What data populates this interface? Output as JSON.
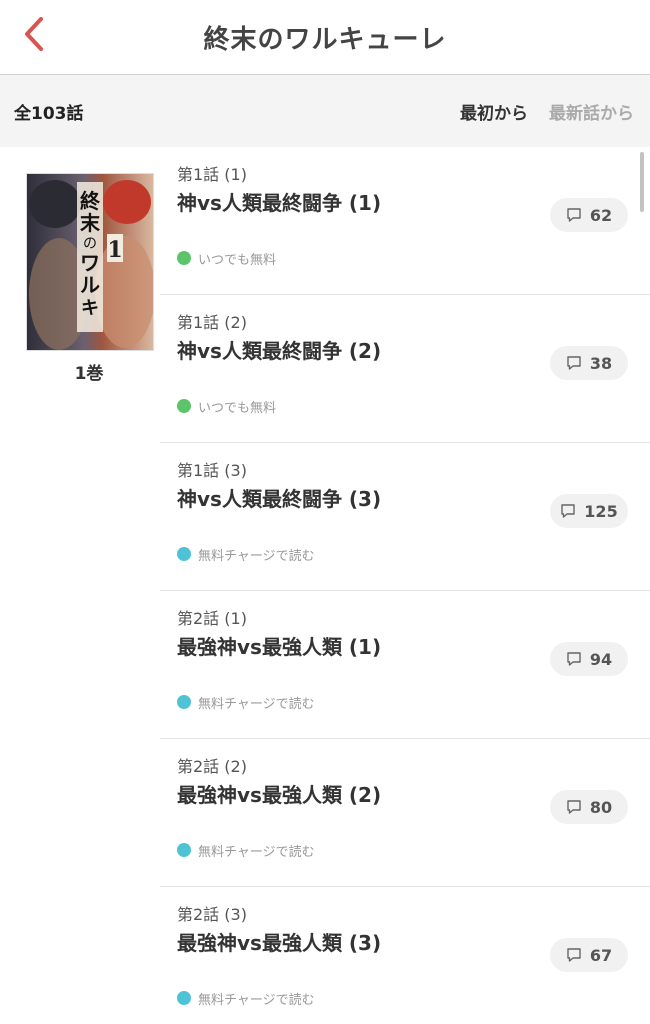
{
  "header": {
    "title": "終末のワルキューレ",
    "back_icon": "chevron-left-icon",
    "accent_color": "#d9534f"
  },
  "subbar": {
    "total": "全103話",
    "sort_first": "最初から",
    "sort_latest": "最新話から"
  },
  "volume": {
    "label": "1巻",
    "cover_title": "終末のワルキューレ",
    "cover_number": "1"
  },
  "status_colors": {
    "free": "#5cc46a",
    "charge": "#4fc3d6"
  },
  "episodes": [
    {
      "sub": "第1話 (1)",
      "title": "神vs人類最終闘争 (1)",
      "comments": "62",
      "status": "いつでも無料",
      "status_type": "free"
    },
    {
      "sub": "第1話 (2)",
      "title": "神vs人類最終闘争 (2)",
      "comments": "38",
      "status": "いつでも無料",
      "status_type": "free"
    },
    {
      "sub": "第1話 (3)",
      "title": "神vs人類最終闘争 (3)",
      "comments": "125",
      "status": "無料チャージで読む",
      "status_type": "charge"
    },
    {
      "sub": "第2話 (1)",
      "title": "最強神vs最強人類 (1)",
      "comments": "94",
      "status": "無料チャージで読む",
      "status_type": "charge"
    },
    {
      "sub": "第2話 (2)",
      "title": "最強神vs最強人類 (2)",
      "comments": "80",
      "status": "無料チャージで読む",
      "status_type": "charge"
    },
    {
      "sub": "第2話 (3)",
      "title": "最強神vs最強人類 (3)",
      "comments": "67",
      "status": "無料チャージで読む",
      "status_type": "charge"
    }
  ]
}
